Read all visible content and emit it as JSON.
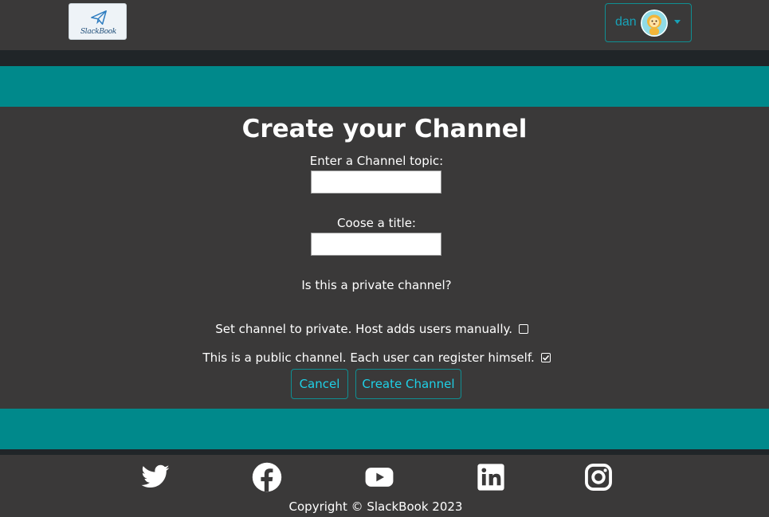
{
  "header": {
    "logo_text": "SlackBook",
    "user": {
      "name": "dan"
    }
  },
  "form": {
    "title": "Create your Channel",
    "topic_label": "Enter a Channel topic:",
    "topic_value": "",
    "title_label": "Coose a title:",
    "title_value": "",
    "privacy_question": "Is this a private channel?",
    "options": [
      {
        "label": "Set channel to private. Host adds users manually.",
        "checked": false
      },
      {
        "label": "This is a public channel. Each user can register himself.",
        "checked": true
      }
    ],
    "cancel_label": "Cancel",
    "create_label": "Create Channel"
  },
  "footer": {
    "social": [
      "twitter-icon",
      "facebook-icon",
      "youtube-icon",
      "linkedin-icon",
      "instagram-icon"
    ],
    "copyright": "Copyright © SlackBook 2023"
  },
  "colors": {
    "background": "#3a3939",
    "accent_teal": "#00898b",
    "button_text": "#1fd0e6",
    "dark_strip": "#202528"
  }
}
